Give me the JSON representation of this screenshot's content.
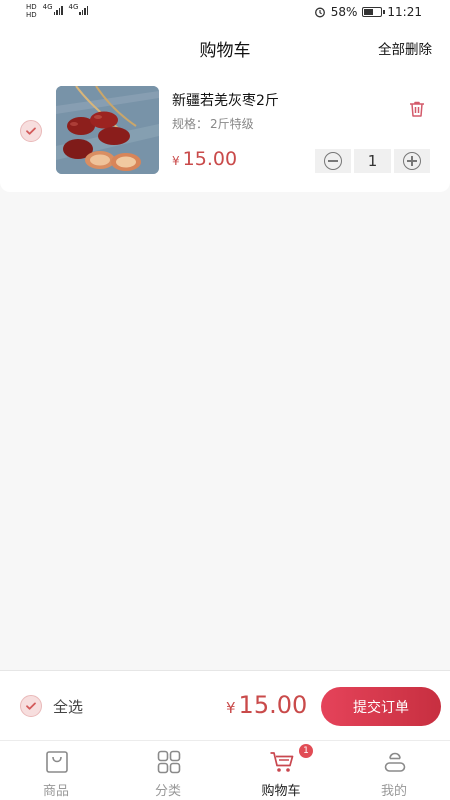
{
  "status_bar": {
    "sim1": "HD",
    "sim2": "HD",
    "net1": "4G",
    "net2": "4G",
    "battery_text": "58%",
    "battery_level": 0.58,
    "time": "11:21"
  },
  "header": {
    "title": "购物车",
    "delete_all": "全部删除"
  },
  "cart": {
    "items": [
      {
        "name": "新疆若羌灰枣2斤",
        "spec_label": "规格：",
        "spec_value": "2斤特级",
        "currency": "¥",
        "price": "15.00",
        "quantity": "1",
        "checked": true
      }
    ]
  },
  "footer": {
    "select_all": "全选",
    "currency": "¥",
    "total": "15.00",
    "submit": "提交订单"
  },
  "tabs": [
    {
      "label": "商品",
      "icon": "bag-icon",
      "active": false
    },
    {
      "label": "分类",
      "icon": "grid-icon",
      "active": false
    },
    {
      "label": "购物车",
      "icon": "cart-icon",
      "active": true,
      "badge": "1"
    },
    {
      "label": "我的",
      "icon": "user-icon",
      "active": false
    }
  ],
  "colors": {
    "accent": "#c94a4a",
    "submit_gradient_start": "#e5435a",
    "submit_gradient_end": "#c72f40",
    "badge": "#e14c55"
  }
}
